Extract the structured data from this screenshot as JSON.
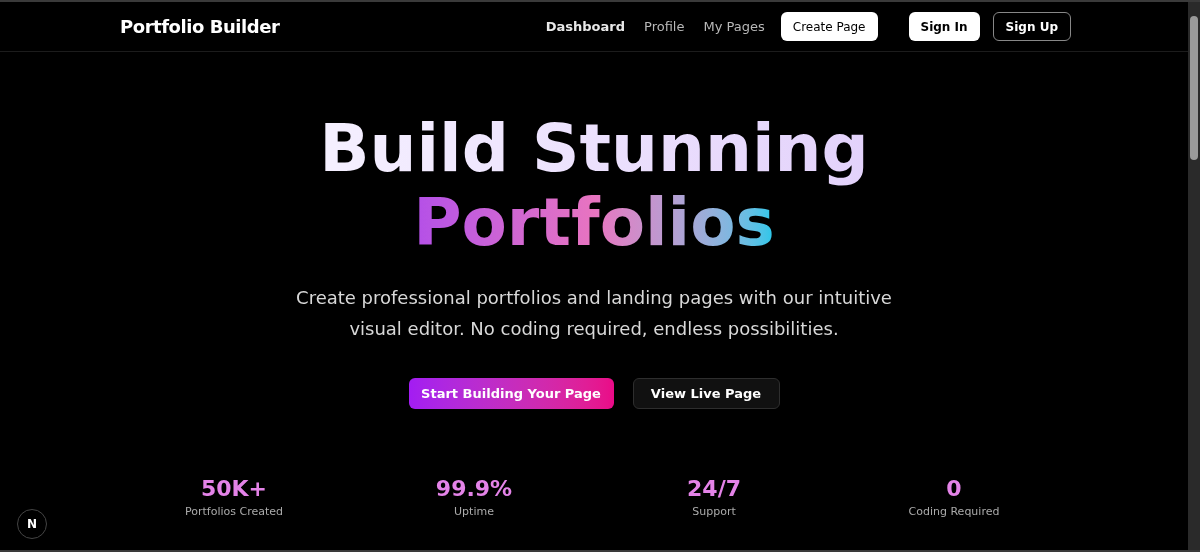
{
  "header": {
    "brand": "Portfolio Builder",
    "nav": [
      {
        "label": "Dashboard",
        "selected": true
      },
      {
        "label": "Profile",
        "selected": false
      },
      {
        "label": "My Pages",
        "selected": false
      }
    ],
    "create_button": "Create Page",
    "auth_buttons": [
      {
        "label": "Sign In",
        "kind": "filled"
      },
      {
        "label": "Sign Up",
        "kind": "outline"
      }
    ]
  },
  "hero": {
    "title_line_1": "Build Stunning",
    "title_line_2": "Portfolios",
    "subtitle": "Create professional portfolios and landing pages with our intuitive visual editor. No coding required, endless possibilities.",
    "buttons": [
      {
        "label": "Start Building Your Page",
        "kind": "primary"
      },
      {
        "label": "View Live Page",
        "kind": "secondary"
      }
    ]
  },
  "stats": [
    {
      "value": "50K+",
      "label": "Portfolios Created"
    },
    {
      "value": "99.9%",
      "label": "Uptime"
    },
    {
      "value": "24/7",
      "label": "Support"
    },
    {
      "value": "0",
      "label": "Coding Required"
    }
  ],
  "dev_badge": {
    "letter": "N"
  }
}
